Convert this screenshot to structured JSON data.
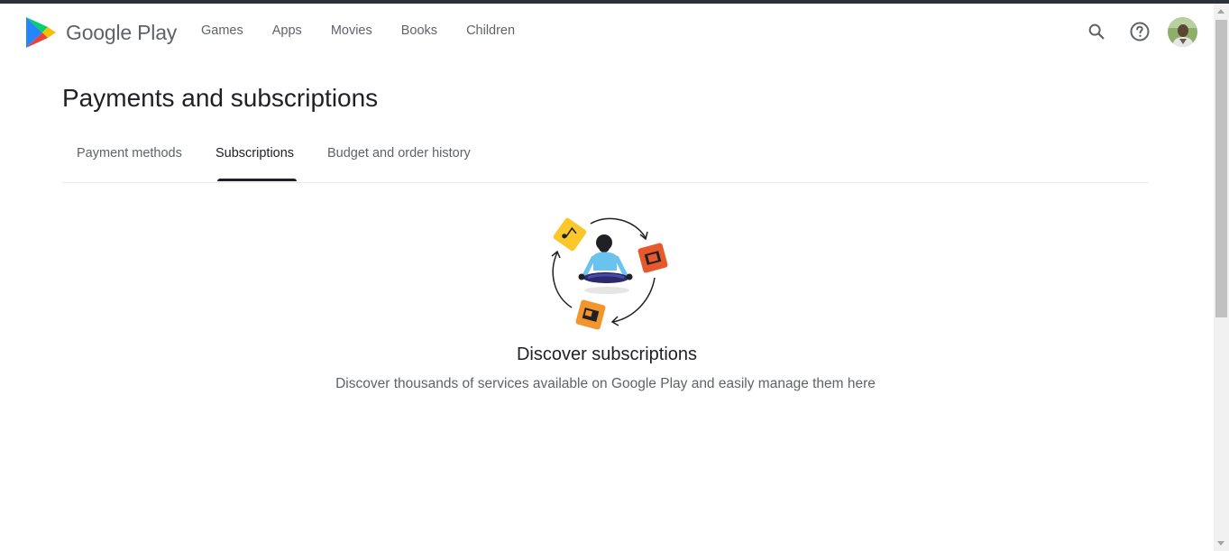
{
  "brand": {
    "name": "Google Play"
  },
  "nav": {
    "items": [
      {
        "label": "Games"
      },
      {
        "label": "Apps"
      },
      {
        "label": "Movies"
      },
      {
        "label": "Books"
      },
      {
        "label": "Children"
      }
    ]
  },
  "header_actions": {
    "search_icon": "search-icon",
    "help_icon": "help-icon",
    "avatar_icon": "account-avatar"
  },
  "page": {
    "title": "Payments and subscriptions",
    "tabs": [
      {
        "label": "Payment methods",
        "active": false
      },
      {
        "label": "Subscriptions",
        "active": true
      },
      {
        "label": "Budget and order history",
        "active": false
      }
    ]
  },
  "empty_state": {
    "title": "Discover subscriptions",
    "description": "Discover thousands of services available on Google Play and easily manage them here"
  },
  "colors": {
    "tab_active": "#202124",
    "text_secondary": "#5f6368",
    "play_green": "#00d26a",
    "play_blue": "#3ea6ff",
    "play_red": "#ea4335",
    "play_yellow": "#fbbc04"
  }
}
